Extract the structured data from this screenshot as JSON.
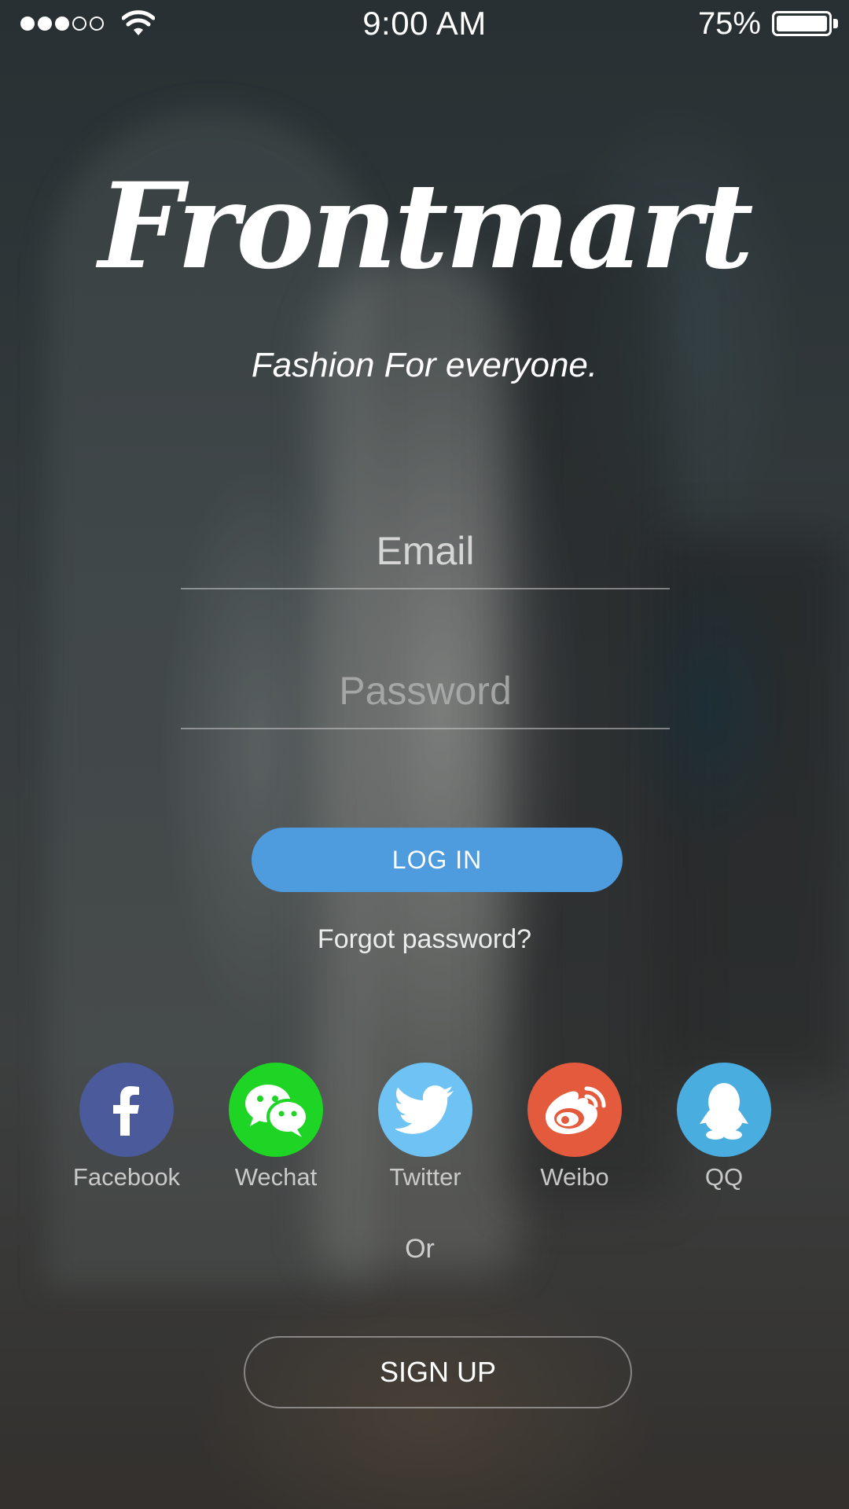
{
  "status_bar": {
    "signal_bars_filled": 3,
    "signal_bars_total": 5,
    "time": "9:00 AM",
    "battery_percent": "75%"
  },
  "brand": {
    "logo_text": "Frontmart",
    "tagline": "Fashion For everyone."
  },
  "form": {
    "email_placeholder": "Email",
    "password_placeholder": "Password",
    "login_label": "LOG IN",
    "forgot_label": "Forgot password?"
  },
  "social": [
    {
      "label": "Facebook",
      "icon": "facebook-icon",
      "color": "#4a5a9a"
    },
    {
      "label": "Wechat",
      "icon": "wechat-icon",
      "color": "#1ed424"
    },
    {
      "label": "Twitter",
      "icon": "twitter-icon",
      "color": "#6ec3f4"
    },
    {
      "label": "Weibo",
      "icon": "weibo-icon",
      "color": "#e45a3d"
    },
    {
      "label": "QQ",
      "icon": "qq-icon",
      "color": "#4aade0"
    }
  ],
  "or_label": "Or",
  "signup_label": "SIGN UP",
  "colors": {
    "login_button": "#4e9bdd"
  }
}
